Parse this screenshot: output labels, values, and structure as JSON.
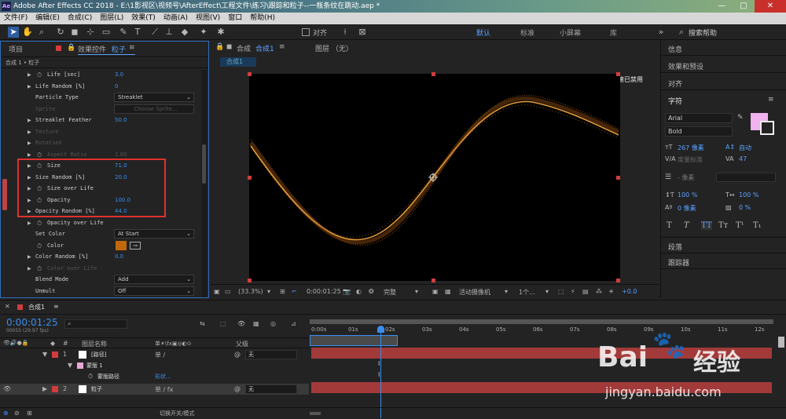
{
  "window": {
    "title": "Adobe After Effects CC 2018 - E:\\1影视区\\视频号\\AfterEffect\\工程文件\\练习\\跟踪和粒子--一瓶条纹在跳动.aep *",
    "logo_text": "Ae",
    "minimize": "—",
    "maximize": "□",
    "close": "✕"
  },
  "menu": [
    "文件(F)",
    "编辑(E)",
    "合成(C)",
    "图层(L)",
    "效果(T)",
    "动画(A)",
    "视图(V)",
    "窗口",
    "帮助(H)"
  ],
  "toolbar": {
    "align_label": "对齐",
    "workspaces": [
      "默认",
      "标准",
      "小屏幕",
      "库"
    ],
    "active_workspace": "默认",
    "search_placeholder": "搜索帮助"
  },
  "left_panel": {
    "tab_project": "项目",
    "tab_effects": "效果控件",
    "tab_effects_target": "粒子",
    "breadcrumb": "合成 1 • 粒子",
    "rows": [
      {
        "label": "Life [sec]",
        "value": "3.0",
        "kind": "value",
        "stopwatch": true
      },
      {
        "label": "Life Random [%]",
        "value": "0",
        "kind": "value",
        "stopwatch": false
      },
      {
        "label": "Particle Type",
        "value": "Streaklet",
        "kind": "dropdown",
        "stopwatch": false
      },
      {
        "label": "Sprite",
        "value": "Choose Sprite...",
        "kind": "button-dim",
        "stopwatch": false,
        "dim": true
      },
      {
        "label": "Streaklet Feather",
        "value": "50.0",
        "kind": "value",
        "stopwatch": false
      },
      {
        "label": "Texture",
        "value": "",
        "kind": "group",
        "dim": true
      },
      {
        "label": "Rotation",
        "value": "",
        "kind": "group",
        "dim": true
      },
      {
        "label": "Aspect Ratio",
        "value": "1.00",
        "kind": "value",
        "stopwatch": true,
        "dim": true
      },
      {
        "label": "Size",
        "value": "71.0",
        "kind": "value",
        "stopwatch": true
      },
      {
        "label": "Size Random [%]",
        "value": "20.0",
        "kind": "value",
        "stopwatch": false
      },
      {
        "label": "Size over Life",
        "value": "",
        "kind": "group",
        "stopwatch": true
      },
      {
        "label": "Opacity",
        "value": "100.0",
        "kind": "value",
        "stopwatch": true
      },
      {
        "label": "Opacity Random [%]",
        "value": "44.0",
        "kind": "value",
        "stopwatch": false
      },
      {
        "label": "Opacity over Life",
        "value": "",
        "kind": "group",
        "stopwatch": true
      },
      {
        "label": "Set Color",
        "value": "At Start",
        "kind": "dropdown",
        "stopwatch": false
      },
      {
        "label": "Color",
        "value": "",
        "kind": "color",
        "stopwatch": true
      },
      {
        "label": "Color Random [%]",
        "value": "0.0",
        "kind": "value",
        "stopwatch": false
      },
      {
        "label": "Color over Life",
        "value": "",
        "kind": "group",
        "stopwatch": true,
        "dim": true
      },
      {
        "label": "Blend Mode",
        "value": "Add",
        "kind": "dropdown",
        "stopwatch": false
      },
      {
        "label": "Unmult",
        "value": "Off",
        "kind": "dropdown",
        "stopwatch": false
      }
    ],
    "color_swatch": "#c0680a"
  },
  "viewer": {
    "tab_comp_prefix": "合成",
    "tab_comp": "合成1",
    "tab_layer": "图层 （无）",
    "comp_chip": "合成1",
    "gpu_notice": "显示加速已禁用",
    "zoom": "(33.3%)",
    "timecode": "0:00:01:25",
    "resolution": "完整",
    "camera": "活动摄像机",
    "views": "1个...",
    "exposure": "+0.0"
  },
  "right_panel": {
    "items": [
      "信息",
      "效果和预设",
      "对齐",
      "字符"
    ],
    "font_family": "Arial",
    "font_style": "Bold",
    "font_size": "267 像素",
    "leading": "自动",
    "kerning": "度量标准",
    "tracking": "47",
    "stroke_width": "- 像素",
    "vscale": "100 %",
    "hscale": "100 %",
    "baseline": "0 像素",
    "tsume": "0 %",
    "styles": [
      "T",
      "T",
      "TT",
      "Tт",
      "T¹",
      "T₁"
    ],
    "paragraph": "段落",
    "tracker": "跟踪器",
    "fill_color": "#f1b2f0"
  },
  "timeline": {
    "tab": "合成1",
    "timecode": "0:00:01:25",
    "frame_info": "00055 (29.97 fps)",
    "col_num": "#",
    "col_name": "图层名称",
    "col_parent": "父级",
    "ruler": [
      "0:00s",
      "01s",
      "02s",
      "03s",
      "04s",
      "05s",
      "06s",
      "07s",
      "08s",
      "09s",
      "10s",
      "11s",
      "12s"
    ],
    "layers": [
      {
        "num": "1",
        "name": "[路径]",
        "parent": "无",
        "color": "#d23c3c"
      },
      {
        "num": "",
        "name": "蒙版 1",
        "parent": "",
        "color": "#e8a7d6"
      },
      {
        "num": "",
        "name": "蒙版路径",
        "parent": "形状...",
        "color": ""
      },
      {
        "num": "2",
        "name": "粒子",
        "parent": "无",
        "color": "#d23c3c"
      }
    ],
    "switch_mode": "切换开关/模式"
  },
  "watermark": {
    "brand": "Bai",
    "brand2": "经验",
    "url": "jingyan.baidu.com"
  }
}
